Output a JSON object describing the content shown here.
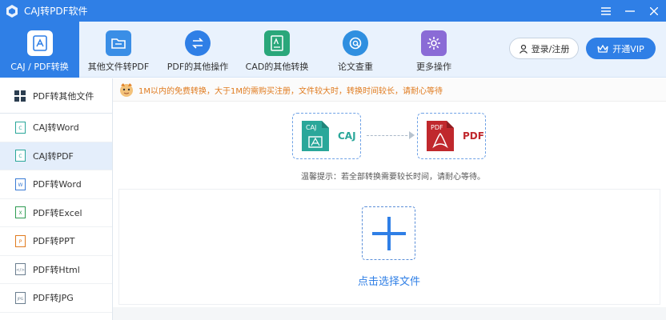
{
  "window": {
    "title": "CAJ转PDF软件",
    "controls": [
      "menu-icon",
      "minimize-icon",
      "close-icon"
    ]
  },
  "toolbar": {
    "items": [
      {
        "label": "CAJ / PDF转换",
        "icon": "pdf-convert-icon",
        "color": "#2f7fe6",
        "active": true
      },
      {
        "label": "其他文件转PDF",
        "icon": "folder-icon",
        "color": "#3a8ee6"
      },
      {
        "label": "PDF的其他操作",
        "icon": "swap-icon",
        "color": "#2f7fe6"
      },
      {
        "label": "CAD的其他转换",
        "icon": "cad-file-icon",
        "color": "#2aa77a"
      },
      {
        "label": "论文查重",
        "icon": "at-check-icon",
        "color": "#2f8fe0"
      },
      {
        "label": "更多操作",
        "icon": "gear-icon",
        "color": "#8a6bd6"
      }
    ],
    "login_label": "登录/注册",
    "vip_label": "开通VIP"
  },
  "sidebar": {
    "header": "PDF转其他文件",
    "items": [
      {
        "label": "CAJ转Word",
        "icon": "caj-icon",
        "active": false
      },
      {
        "label": "CAJ转PDF",
        "icon": "caj-icon",
        "active": true
      },
      {
        "label": "PDF转Word",
        "icon": "word-icon",
        "active": false
      },
      {
        "label": "PDF转Excel",
        "icon": "excel-icon",
        "active": false
      },
      {
        "label": "PDF转PPT",
        "icon": "ppt-icon",
        "active": false
      },
      {
        "label": "PDF转Html",
        "icon": "html-icon",
        "active": false
      },
      {
        "label": "PDF转JPG",
        "icon": "jpg-icon",
        "active": false
      }
    ]
  },
  "notice": "1M以内的免费转换，大于1M的需购买注册，文件较大时，转换时间较长，请耐心等待",
  "conversion": {
    "source": {
      "badge": "CAJ",
      "label": "CAJ",
      "color": "#2aa79a"
    },
    "target": {
      "badge": "PDF",
      "label": "PDF",
      "color": "#c0282d"
    }
  },
  "tip": "温馨提示：若全部转换需要较长时间，请耐心等待。",
  "choose_file_label": "点击选择文件",
  "colors": {
    "accent": "#2f7fe6",
    "warning": "#e07b1f"
  }
}
